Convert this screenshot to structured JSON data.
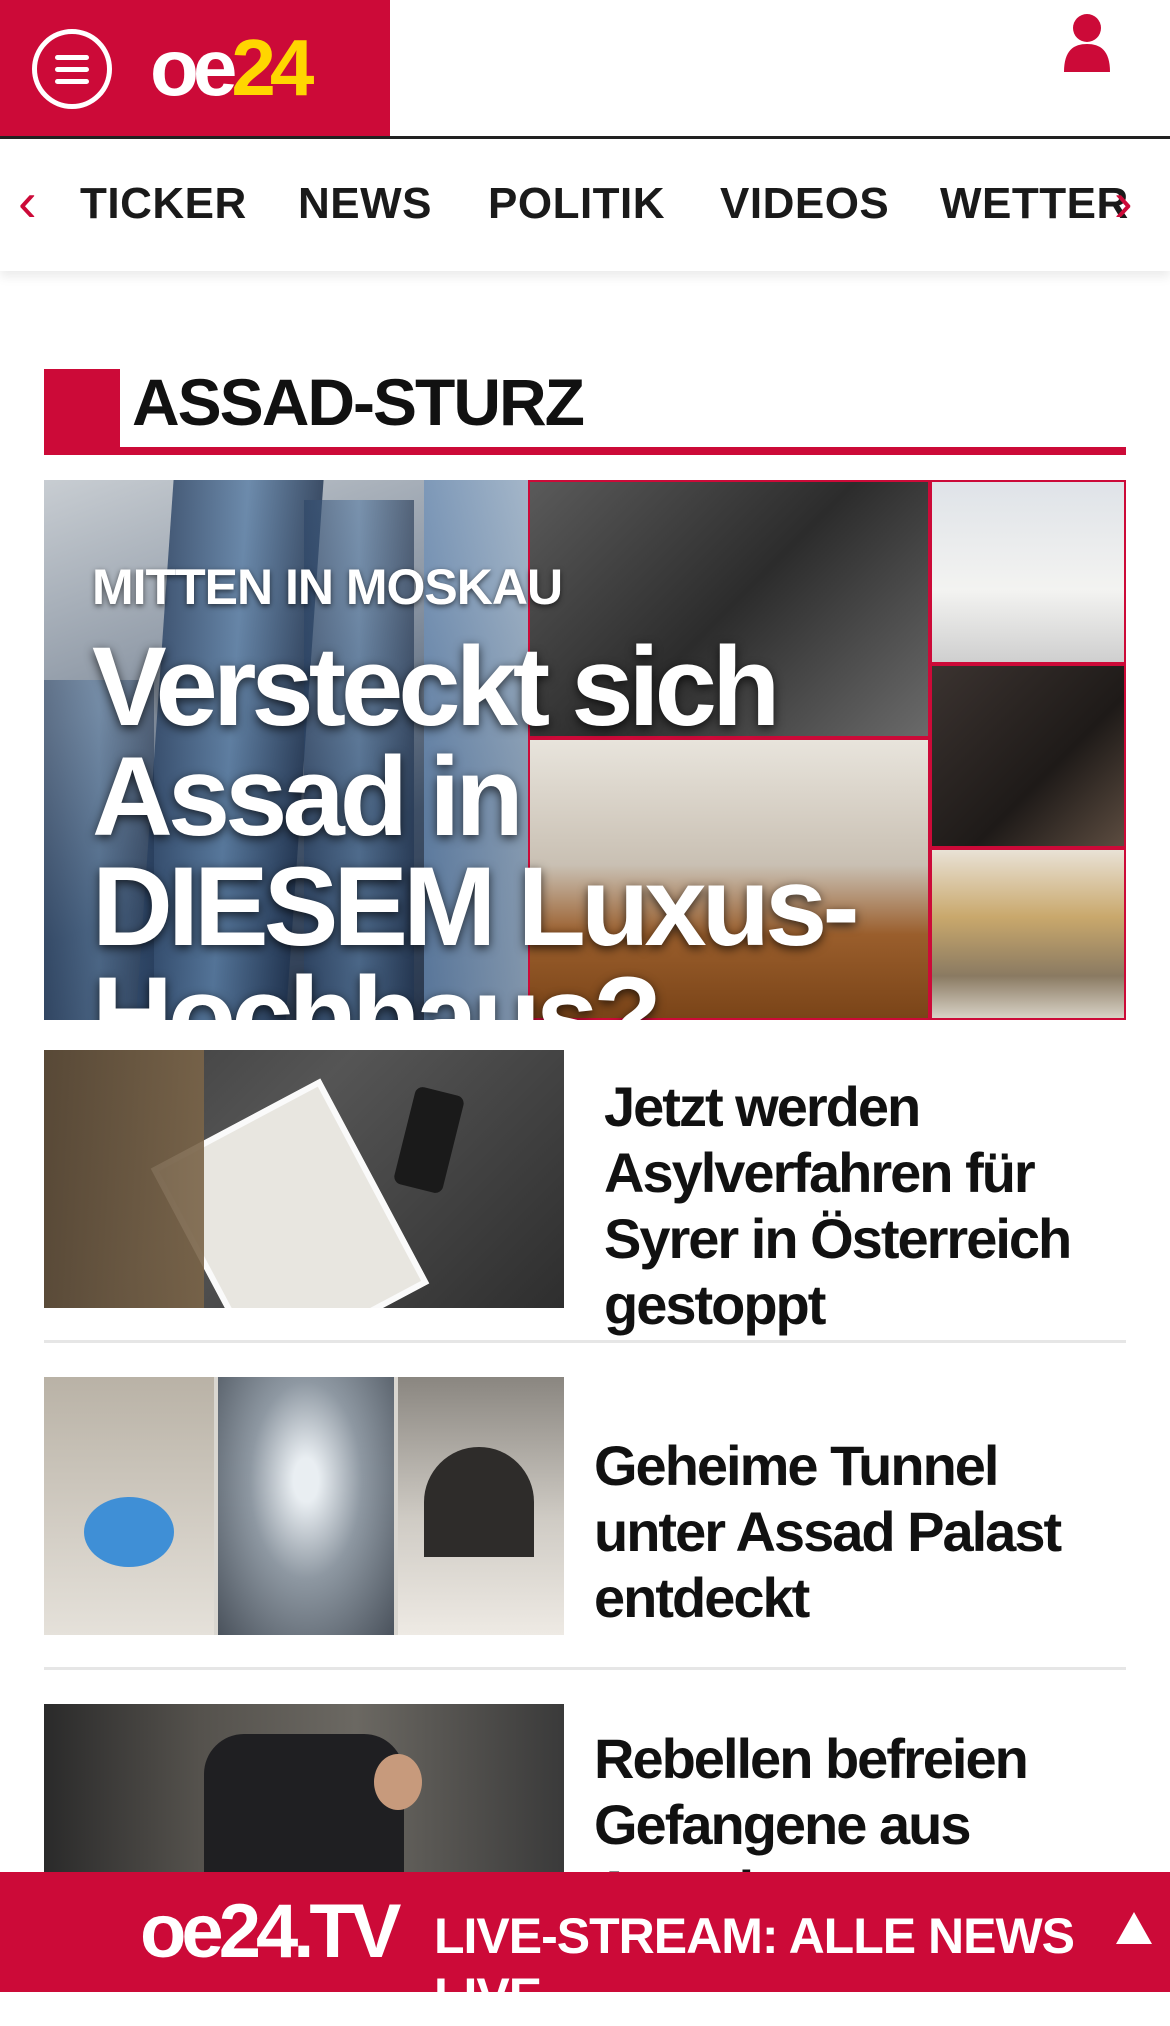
{
  "header": {
    "logo_white": "oe",
    "logo_yellow": "24",
    "brand_color": "#cc0a38",
    "icons": {
      "menu": "hamburger-menu-icon",
      "user": "user-account-icon"
    }
  },
  "nav": {
    "prev_arrow": "‹",
    "next_arrow": "›",
    "items": [
      "TICKER",
      "NEWS",
      "POLITIK",
      "VIDEOS",
      "WETTER"
    ]
  },
  "section": {
    "title": "ASSAD-STURZ"
  },
  "hero": {
    "kicker": "MITTEN IN MOSKAU",
    "headline": "Versteckt sich Assad in DIESEM Luxus-Hochhaus?"
  },
  "articles": [
    {
      "title": "Jetzt werden Asylverfahren für Syrer in Österreich gestoppt"
    },
    {
      "title": "Geheime Tunnel unter Assad Palast entdeckt"
    },
    {
      "title": "Rebellen befreien Gefangene aus Assads"
    }
  ],
  "bottom_bar": {
    "logo": "oe24.TV",
    "live_text": "LIVE-STREAM:  ALLE NEWS LIVE",
    "icon": "scroll-up-arrow-icon"
  }
}
